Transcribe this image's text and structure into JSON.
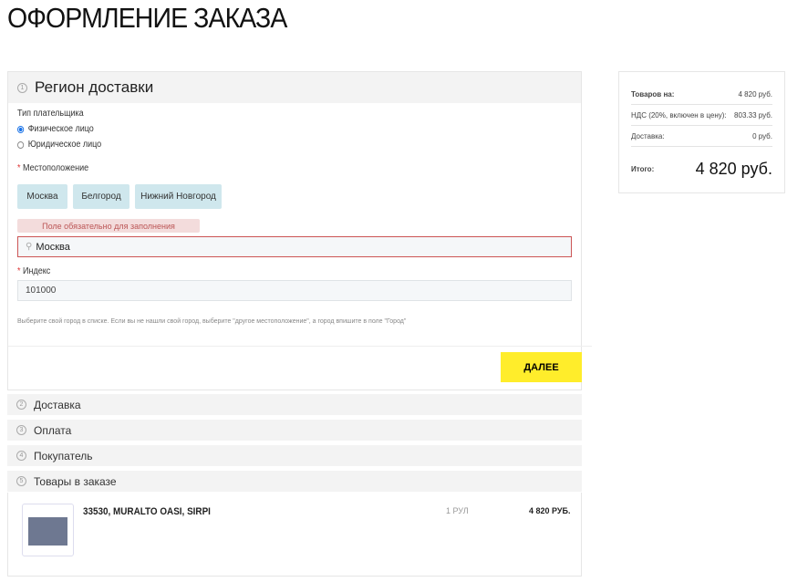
{
  "page_title": "ОФОРМЛЕНИЕ ЗАКАЗА",
  "region": {
    "step": "1",
    "title": "Регион доставки",
    "payer_label": "Тип плательщика",
    "payer_options": [
      "Физическое лицо",
      "Юридическое лицо"
    ],
    "payer_selected": "Физическое лицо",
    "location_label": "Местоположение",
    "required_mark": "*",
    "cities": [
      "Москва",
      "Белгород",
      "Нижний Новгород"
    ],
    "error": "Поле обязательно для заполнения",
    "location_value": "Москва",
    "zip_label": "Индекс",
    "zip_value": "101000",
    "hint": "Выберите свой город в списке. Если вы не нашли свой город, выберите \"другое местоположение\", а город впишите в поле \"Город\"",
    "next_label": "ДАЛЕЕ"
  },
  "sections": [
    {
      "step": "2",
      "title": "Доставка"
    },
    {
      "step": "3",
      "title": "Оплата"
    },
    {
      "step": "4",
      "title": "Покупатель"
    },
    {
      "step": "5",
      "title": "Товары в заказе"
    }
  ],
  "product": {
    "name": "33530, MURALTO OASI, SIRPI",
    "qty": "1 РУЛ",
    "price": "4 820 РУБ."
  },
  "summary": {
    "goods_label": "Товаров на:",
    "goods_value": "4 820 руб.",
    "vat_label": "НДС (20%, включен в цену):",
    "vat_value": "803.33 руб.",
    "delivery_label": "Доставка:",
    "delivery_value": "0 руб.",
    "total_label": "Итого:",
    "total_value": "4 820 руб."
  }
}
